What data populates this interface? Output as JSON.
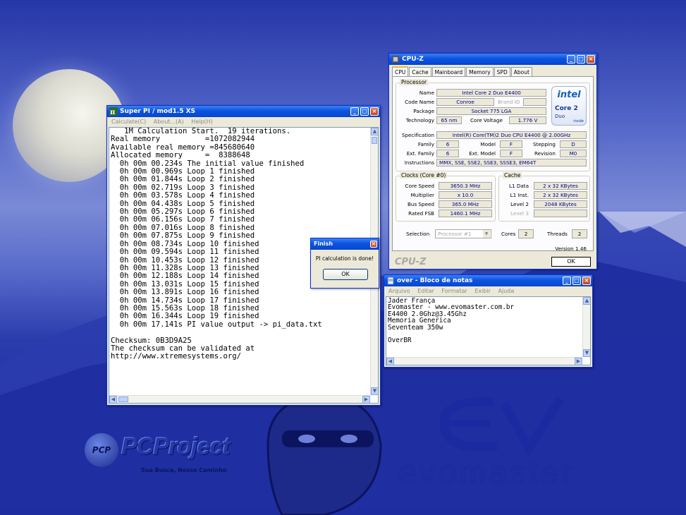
{
  "superpi": {
    "title": "Super PI / mod1.5 XS",
    "menu": [
      "Calculate(C)",
      "About...(A)",
      "Help(H)"
    ],
    "lines": [
      "   1M Calculation Start.  19 iterations.",
      "Real memory          =1072082944",
      "Available real memory =845680640",
      "Allocated memory     =  8388648",
      "  0h 00m 00.234s The initial value finished",
      "  0h 00m 00.969s Loop 1 finished",
      "  0h 00m 01.844s Loop 2 finished",
      "  0h 00m 02.719s Loop 3 finished",
      "  0h 00m 03.578s Loop 4 finished",
      "  0h 00m 04.438s Loop 5 finished",
      "  0h 00m 05.297s Loop 6 finished",
      "  0h 00m 06.156s Loop 7 finished",
      "  0h 00m 07.016s Loop 8 finished",
      "  0h 00m 07.875s Loop 9 finished",
      "  0h 00m 08.734s Loop 10 finished",
      "  0h 00m 09.594s Loop 11 finished",
      "  0h 00m 10.453s Loop 12 finished",
      "  0h 00m 11.328s Loop 13 finished",
      "  0h 00m 12.188s Loop 14 finished",
      "  0h 00m 13.031s Loop 15 finished",
      "  0h 00m 13.891s Loop 16 finished",
      "  0h 00m 14.734s Loop 17 finished",
      "  0h 00m 15.563s Loop 18 finished",
      "  0h 00m 16.344s Loop 19 finished",
      "  0h 00m 17.141s PI value output -> pi_data.txt",
      "",
      "Checksum: 0B3D9A25",
      "The checksum can be validated at",
      "http://www.xtremesystems.org/"
    ]
  },
  "finish": {
    "title": "Finish",
    "message": "PI calculation is done!",
    "ok": "OK"
  },
  "cpuz": {
    "title": "CPU-Z",
    "tabs": [
      "CPU",
      "Cache",
      "Mainboard",
      "Memory",
      "SPD",
      "About"
    ],
    "processor_group": "Processor",
    "name_label": "Name",
    "name": "Intel Core 2 Duo E4400",
    "codename_label": "Code Name",
    "codename": "Conroe",
    "brandid_label": "Brand ID",
    "package_label": "Package",
    "package": "Socket 775 LGA",
    "technology_label": "Technology",
    "technology": "65 nm",
    "corevoltage_label": "Core Voltage",
    "corevoltage": "1.776 V",
    "spec_label": "Specification",
    "spec": "Intel(R) Core(TM)2 Duo CPU    E4400  @ 2.00GHz",
    "family_label": "Family",
    "family": "6",
    "model_label": "Model",
    "model": "F",
    "stepping_label": "Stepping",
    "stepping": "D",
    "extfamily_label": "Ext. Family",
    "extfamily": "6",
    "extmodel_label": "Ext. Model",
    "extmodel": "F",
    "revision_label": "Revision",
    "revision": "M0",
    "instructions_label": "Instructions",
    "instructions": "MMX, SSE, SSE2, SSE3, SSSE3, EM64T",
    "clocks_group": "Clocks (Core #0)",
    "corespeed_label": "Core Speed",
    "corespeed": "3650.3 MHz",
    "multiplier_label": "Multiplier",
    "multiplier": "x 10.0",
    "busspeed_label": "Bus Speed",
    "busspeed": "365.0 MHz",
    "fsb_label": "Rated FSB",
    "fsb": "1460.1 MHz",
    "cache_group": "Cache",
    "l1d_label": "L1 Data",
    "l1d": "2 x 32 KBytes",
    "l1i_label": "L1 Inst.",
    "l1i": "2 x 32 KBytes",
    "l2_label": "Level 2",
    "l2": "2048 KBytes",
    "l3_label": "Level 3",
    "selection_label": "Selection",
    "selection": "Processor #1",
    "cores_label": "Cores",
    "cores": "2",
    "threads_label": "Threads",
    "threads": "2",
    "version": "Version 1.46",
    "brand": "CPU-Z",
    "ok": "OK",
    "intel_logo": {
      "word": "intel",
      "product": "Core 2",
      "sub": "Duo",
      "inside": "inside"
    }
  },
  "notepad": {
    "title": "over - Bloco de notas",
    "menu": [
      "Arquivo",
      "Editar",
      "Formatar",
      "Exibir",
      "Ajuda"
    ],
    "lines": [
      "Jader França",
      "Evomaster - www.evomaster.com.br",
      "E4400 2.0Ghz@3.45Ghz",
      "Memoria Generica",
      "Seventeam 350w",
      "",
      "OverBR"
    ]
  },
  "desktop": {
    "pcproject": "PCProject",
    "pcproject_tag": "Sua Busca, Nosso Caminho",
    "pcp_badge": "PCP",
    "evomaster": "evomaster"
  }
}
